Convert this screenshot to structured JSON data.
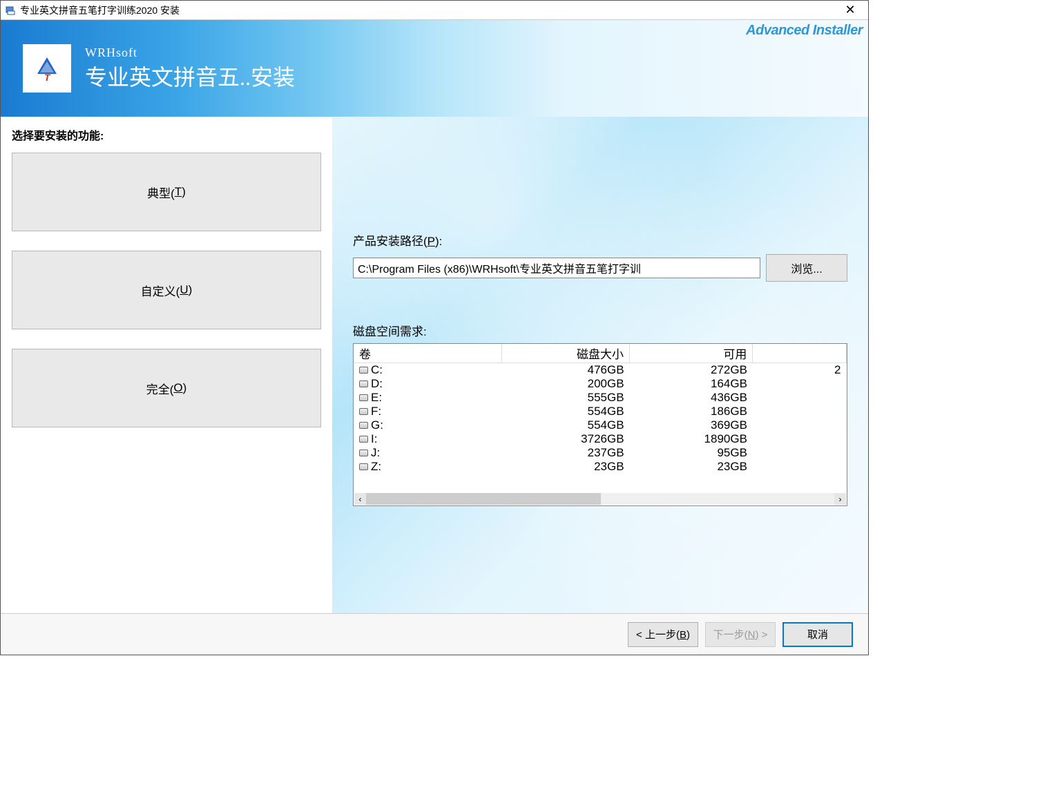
{
  "window": {
    "title": "专业英文拼音五笔打字训练2020 安装"
  },
  "banner": {
    "brand_small": "WRHsoft",
    "brand_big": "专业英文拼音五..安装",
    "adv": "Advanced Installer"
  },
  "left": {
    "heading": "选择要安装的功能:",
    "typical": "典型(",
    "typical_key": "T",
    "typical_after": ")",
    "custom": "自定义(",
    "custom_key": "U",
    "custom_after": ")",
    "complete": "完全(",
    "complete_key": "O",
    "complete_after": ")"
  },
  "path": {
    "label_pre": "产品安装路径(",
    "label_key": "P",
    "label_after": "):",
    "value": "C:\\Program Files (x86)\\WRHsoft\\专业英文拼音五笔打字训",
    "browse": "浏览..."
  },
  "disk": {
    "label": "磁盘空间需求:",
    "headers": {
      "vol": "卷",
      "size": "磁盘大小",
      "avail": "可用"
    },
    "extra_cell": "2",
    "rows": [
      {
        "vol": "C:",
        "size": "476GB",
        "avail": "272GB"
      },
      {
        "vol": "D:",
        "size": "200GB",
        "avail": "164GB"
      },
      {
        "vol": "E:",
        "size": "555GB",
        "avail": "436GB"
      },
      {
        "vol": "F:",
        "size": "554GB",
        "avail": "186GB"
      },
      {
        "vol": "G:",
        "size": "554GB",
        "avail": "369GB"
      },
      {
        "vol": "I:",
        "size": "3726GB",
        "avail": "1890GB"
      },
      {
        "vol": "J:",
        "size": "237GB",
        "avail": "95GB"
      },
      {
        "vol": "Z:",
        "size": "23GB",
        "avail": "23GB"
      }
    ]
  },
  "footer": {
    "back_pre": "< 上一步(",
    "back_key": "B",
    "back_after": ")",
    "next_pre": "下一步(",
    "next_key": "N",
    "next_after": ") >",
    "cancel": "取消"
  }
}
